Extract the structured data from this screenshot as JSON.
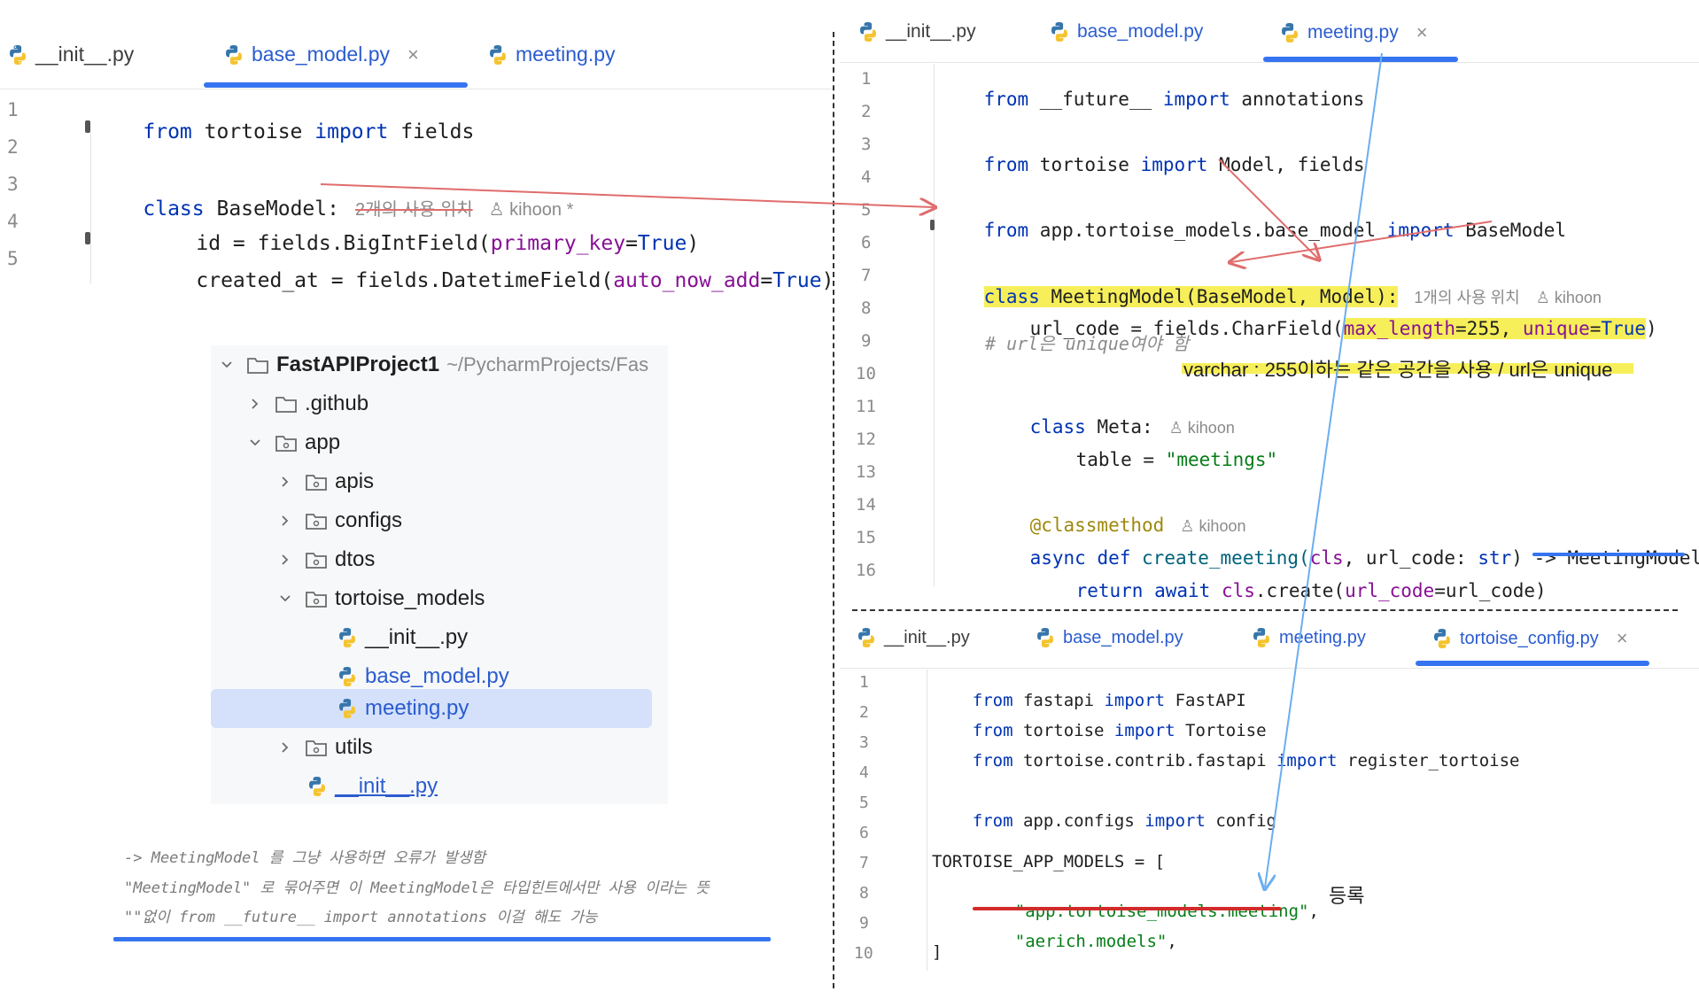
{
  "left_editor": {
    "tabs": [
      {
        "label": "__init__.py",
        "active": false
      },
      {
        "label": "base_model.py",
        "active": true,
        "close": "×"
      },
      {
        "label": "meeting.py",
        "active": false
      }
    ],
    "line_numbers": [
      "1",
      "2",
      "3",
      "4",
      "5"
    ],
    "lines": {
      "l1": {
        "kw1": "from",
        "t1": " tortoise ",
        "kw2": "import",
        "t2": " fields"
      },
      "l3": {
        "kw": "class",
        "t": " BaseModel:",
        "hint1": "2개의 사용 위치",
        "hint2": "kihoon *"
      },
      "l4": {
        "t1": "id = fields.BigIntField(",
        "arg": "primary_key",
        "eq": "=",
        "val": "True",
        "close": ")"
      },
      "l5": {
        "t1": "created_at = fields.DatetimeField(",
        "arg": "auto_now_add",
        "eq": "=",
        "val": "True",
        "close": ")"
      }
    }
  },
  "project_tree": {
    "root_name": "FastAPIProject1",
    "root_path": "~/PycharmProjects/Fas",
    "items": [
      {
        "label": ".github",
        "type": "folder"
      },
      {
        "label": "app",
        "type": "folder"
      },
      {
        "label": "apis",
        "type": "folder"
      },
      {
        "label": "configs",
        "type": "folder"
      },
      {
        "label": "dtos",
        "type": "folder"
      },
      {
        "label": "tortoise_models",
        "type": "folder"
      },
      {
        "label": "__init__.py",
        "type": "file"
      },
      {
        "label": "base_model.py",
        "type": "file"
      },
      {
        "label": "meeting.py",
        "type": "file",
        "selected": true
      },
      {
        "label": "utils",
        "type": "folder"
      },
      {
        "label": "__init__.py",
        "type": "file"
      }
    ]
  },
  "notes": {
    "line1": "-> MeetingModel 를 그냥 사용하면 오류가 발생함",
    "line2": "\"MeetingModel\" 로 묶어주면 이 MeetingModel은 타입힌트에서만 사용 이라는 뜻",
    "line3": "\"\"없이 from __future__ import annotations 이걸 해도 가능"
  },
  "right_top_editor": {
    "tabs": [
      {
        "label": "__init__.py",
        "active": false
      },
      {
        "label": "base_model.py",
        "active": false
      },
      {
        "label": "meeting.py",
        "active": true,
        "close": "×"
      }
    ],
    "line_numbers": [
      "1",
      "2",
      "3",
      "4",
      "5",
      "6",
      "7",
      "8",
      "9",
      "10",
      "11",
      "12",
      "13",
      "14",
      "15",
      "16"
    ],
    "lines": {
      "l1": {
        "kw1": "from",
        "t1": " __future__ ",
        "kw2": "import",
        "t2": " annotations"
      },
      "l3": {
        "kw1": "from",
        "t1": " tortoise ",
        "kw2": "import",
        "t2": " Model, fields"
      },
      "l5": {
        "kw1": "from",
        "t1": " app.tortoise_models.base_model ",
        "kw2": "import",
        "t2": " BaseModel"
      },
      "l7": {
        "kw": "class",
        "t": " MeetingModel(BaseModel, Model):",
        "hint": "1개의 사용 위치",
        "user": "kihoon"
      },
      "l8": {
        "t1": "url_code = fields.CharField(",
        "a1": "max_length",
        "v1": "=255, ",
        "a2": "unique",
        "v2": "=",
        "v3": "True",
        "close": ")"
      },
      "l9": {
        "cmt": "# url은 unique여야 함"
      },
      "l11": {
        "kw": "class",
        "t": " Meta:",
        "user": "kihoon"
      },
      "l12": {
        "t": "table = ",
        "str": "\"meetings\""
      },
      "l14": {
        "dec": "@classmethod",
        "user": "kihoon"
      },
      "l15": {
        "kw1": "async",
        "kw2": "def",
        "fn": " create_meeting(",
        "cls": "cls",
        "t2": ", url_code: ",
        "typ": "str",
        "t3": ") -> MeetingModel:"
      },
      "l16": {
        "kw1": "return",
        "kw2": "await",
        "cls": "cls",
        "t": ".create(",
        "arg": "url_code",
        "t2": "=url_code)"
      }
    },
    "annotation": "varchar : 255이하는 같은 공간을 사용 / url은 unique"
  },
  "right_bottom_editor": {
    "tabs": [
      {
        "label": "__init__.py",
        "active": false
      },
      {
        "label": "base_model.py",
        "active": false
      },
      {
        "label": "meeting.py",
        "active": false
      },
      {
        "label": "tortoise_config.py",
        "active": true,
        "close": "×"
      }
    ],
    "line_numbers": [
      "1",
      "2",
      "3",
      "4",
      "5",
      "6",
      "7",
      "8",
      "9",
      "10"
    ],
    "lines": {
      "l1": {
        "kw1": "from",
        "t1": " fastapi ",
        "kw2": "import",
        "t2": " FastAPI"
      },
      "l2": {
        "kw1": "from",
        "t1": " tortoise ",
        "kw2": "import",
        "t2": " Tortoise"
      },
      "l3": {
        "kw1": "from",
        "t1": " tortoise.contrib.fastapi ",
        "kw2": "import",
        "t2": " register_tortoise"
      },
      "l5": {
        "kw1": "from",
        "t1": " app.configs ",
        "kw2": "import",
        "t2": " config"
      },
      "l7": {
        "t": "TORTOISE_APP_MODELS = ["
      },
      "l8": {
        "str": "\"app.tortoise_models.meeting\"",
        "t": ","
      },
      "l9": {
        "str": "\"aerich.models\"",
        "t": ","
      },
      "l10": {
        "t": "]"
      }
    },
    "annotation": "등록"
  },
  "colors": {
    "accent": "#3574f0",
    "keyword": "#0033b3",
    "param": "#871094",
    "string": "#067d17",
    "highlight": "#f7ef5a",
    "arrow_red": "#e06c6c",
    "arrow_blue": "#6aaef0",
    "underline_red": "#d12b2b"
  }
}
